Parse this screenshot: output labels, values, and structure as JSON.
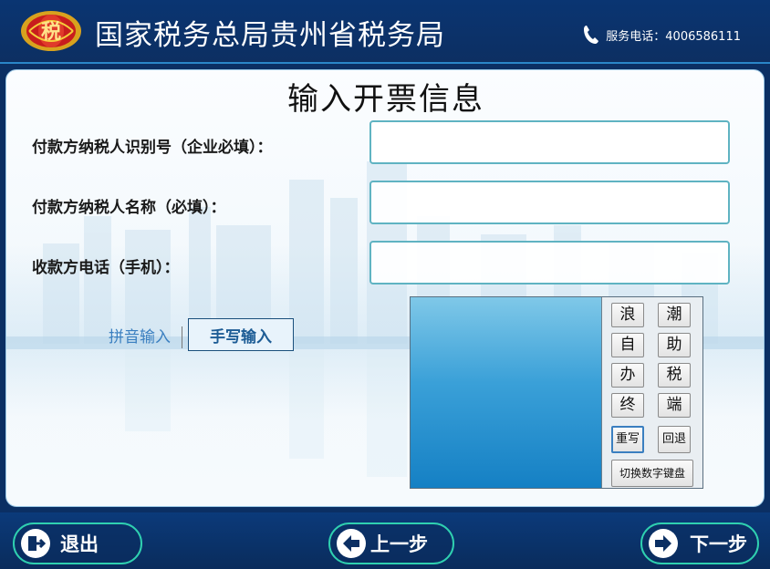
{
  "header": {
    "title": "国家税务总局贵州省税务局",
    "emblem_text": "税",
    "phone_label": "服务电话：4006586111"
  },
  "page": {
    "title": "输入开票信息"
  },
  "fields": [
    {
      "label": "付款方纳税人识别号（企业必填）：",
      "value": ""
    },
    {
      "label": "付款方纳税人名称（必填）：",
      "value": ""
    },
    {
      "label": "收款方电话（手机）：",
      "value": ""
    }
  ],
  "ime": {
    "pinyin_label": "拼音输入",
    "handwrite_label": "手写输入",
    "selected": "手写输入"
  },
  "handwriting": {
    "candidates": [
      "浪",
      "潮",
      "自",
      "助",
      "办",
      "税",
      "终",
      "端"
    ],
    "rewrite_label": "重写",
    "backspace_label": "回退",
    "switch_label": "切换数字键盘"
  },
  "footer": {
    "exit_label": "退出",
    "prev_label": "上一步",
    "next_label": "下一步"
  },
  "colors": {
    "header_bg": "#0a3572",
    "accent_teal": "#2fd0b0",
    "input_border": "#5fb3c2",
    "pad_blue": "#1580c4"
  }
}
